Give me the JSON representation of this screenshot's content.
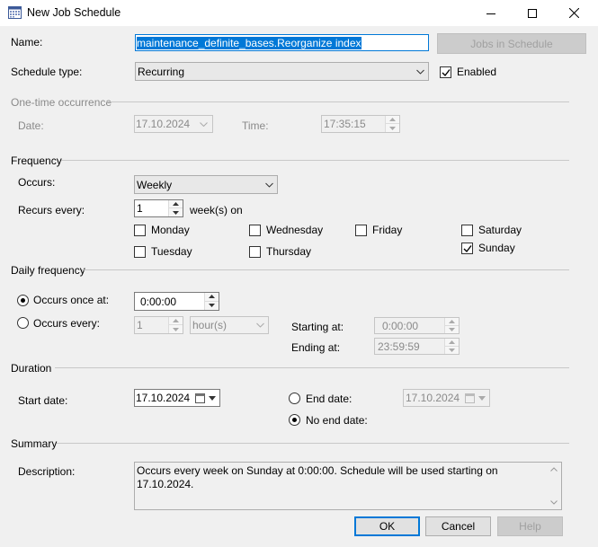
{
  "window": {
    "title": "New Job Schedule"
  },
  "name_label": "Name:",
  "name_value": "maintenance_definite_bases.Reorganize index",
  "jobs_button": "Jobs in Schedule",
  "schedule_type_label": "Schedule type:",
  "schedule_type_value": "Recurring",
  "enabled_label": "Enabled",
  "enabled_checked": true,
  "one_time": {
    "header": "One-time occurrence",
    "date_label": "Date:",
    "date_value": "17.10.2024",
    "time_label": "Time:",
    "time_value": "17:35:15"
  },
  "frequency": {
    "header": "Frequency",
    "occurs_label": "Occurs:",
    "occurs_value": "Weekly",
    "recurs_label": "Recurs every:",
    "recurs_value": "1",
    "recurs_unit": "week(s) on",
    "days": {
      "monday": {
        "label": "Monday",
        "checked": false
      },
      "tuesday": {
        "label": "Tuesday",
        "checked": false
      },
      "wednesday": {
        "label": "Wednesday",
        "checked": false
      },
      "thursday": {
        "label": "Thursday",
        "checked": false
      },
      "friday": {
        "label": "Friday",
        "checked": false
      },
      "saturday": {
        "label": "Saturday",
        "checked": false
      },
      "sunday": {
        "label": "Sunday",
        "checked": true
      }
    }
  },
  "daily": {
    "header": "Daily frequency",
    "once_label": "Occurs once at:",
    "once_value": "0:00:00",
    "every_label": "Occurs every:",
    "every_value": "1",
    "every_unit": "hour(s)",
    "starting_label": "Starting at:",
    "starting_value": "0:00:00",
    "ending_label": "Ending at:",
    "ending_value": "23:59:59",
    "selected": "once"
  },
  "duration": {
    "header": "Duration",
    "start_label": "Start date:",
    "start_value": "17.10.2024",
    "end_label": "End date:",
    "end_value": "17.10.2024",
    "no_end_label": "No end date:",
    "selected": "no_end"
  },
  "summary": {
    "header": "Summary",
    "description_label": "Description:",
    "description_text": "Occurs every week on Sunday at 0:00:00. Schedule will be used starting on 17.10.2024."
  },
  "buttons": {
    "ok": "OK",
    "cancel": "Cancel",
    "help": "Help"
  },
  "colors": {
    "accent": "#0078d7",
    "dialog_bg": "#f0f0f0",
    "disabled_text": "#8a8a8a"
  }
}
